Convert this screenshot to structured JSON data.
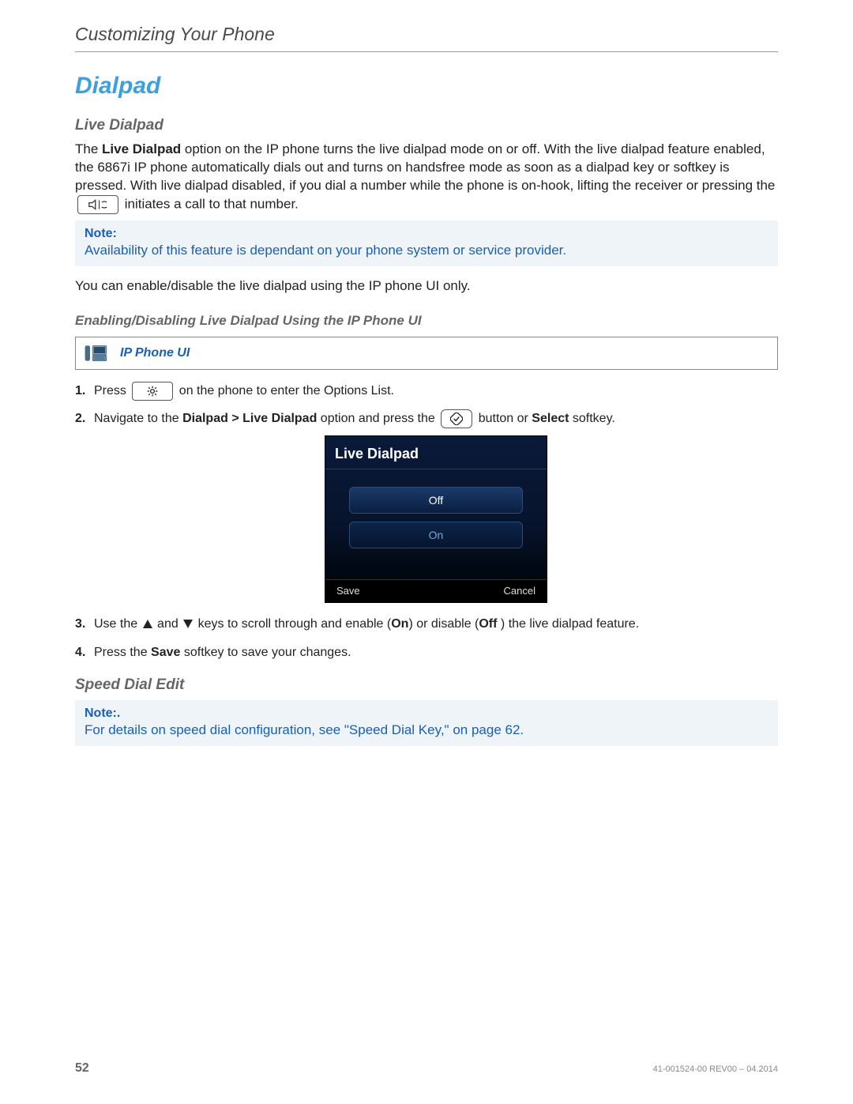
{
  "header": {
    "chapter": "Customizing Your Phone"
  },
  "h1": "Dialpad",
  "liveDialpad": {
    "heading": "Live Dialpad",
    "para1_a": "The ",
    "para1_b": "Live Dialpad",
    "para1_c": " option on the IP phone turns the live dialpad mode on or off. With the live dialpad feature enabled, the 6867i IP phone automatically dials out and turns on handsfree mode as soon as a dialpad key or softkey is pressed. With live dialpad disabled, if you dial a number while the phone is on-hook, lifting the receiver or pressing the ",
    "para1_d": " initiates a call to that number.",
    "note_label": "Note:",
    "note_text": "Availability of this feature is dependant on your phone system or service provider.",
    "para2": "You can enable/disable the live dialpad using the IP phone UI only.",
    "subheading": "Enabling/Disabling Live Dialpad Using the IP Phone UI",
    "ui_label": "IP Phone UI",
    "step1_a": "Press ",
    "step1_b": " on the phone to enter the Options List.",
    "step2_a": "Navigate to the ",
    "step2_b": "Dialpad > Live Dialpad",
    "step2_c": " option and press the ",
    "step2_d": " button or ",
    "step2_e": "Select",
    "step2_f": " softkey.",
    "screenshot": {
      "title": "Live Dialpad",
      "off": "Off",
      "on": "On",
      "save": "Save",
      "cancel": "Cancel"
    },
    "step3_a": "Use the ",
    "step3_b": " and ",
    "step3_c": " keys to scroll through and enable (",
    "step3_d": "On",
    "step3_e": ") or disable (",
    "step3_f": "Off",
    "step3_g": " ) the live dialpad feature.",
    "step4_a": "Press the ",
    "step4_b": "Save",
    "step4_c": " softkey to save your changes."
  },
  "speedDial": {
    "heading": "Speed Dial Edit",
    "note_label": "Note:.",
    "note_text_a": "For details on speed dial configuration, see ",
    "note_text_b": "\"Speed Dial Key,\"",
    "note_text_c": " on ",
    "note_text_d": "page 62",
    "note_text_e": "."
  },
  "footer": {
    "page": "52",
    "docrev": "41-001524-00 REV00 – 04.2014"
  }
}
